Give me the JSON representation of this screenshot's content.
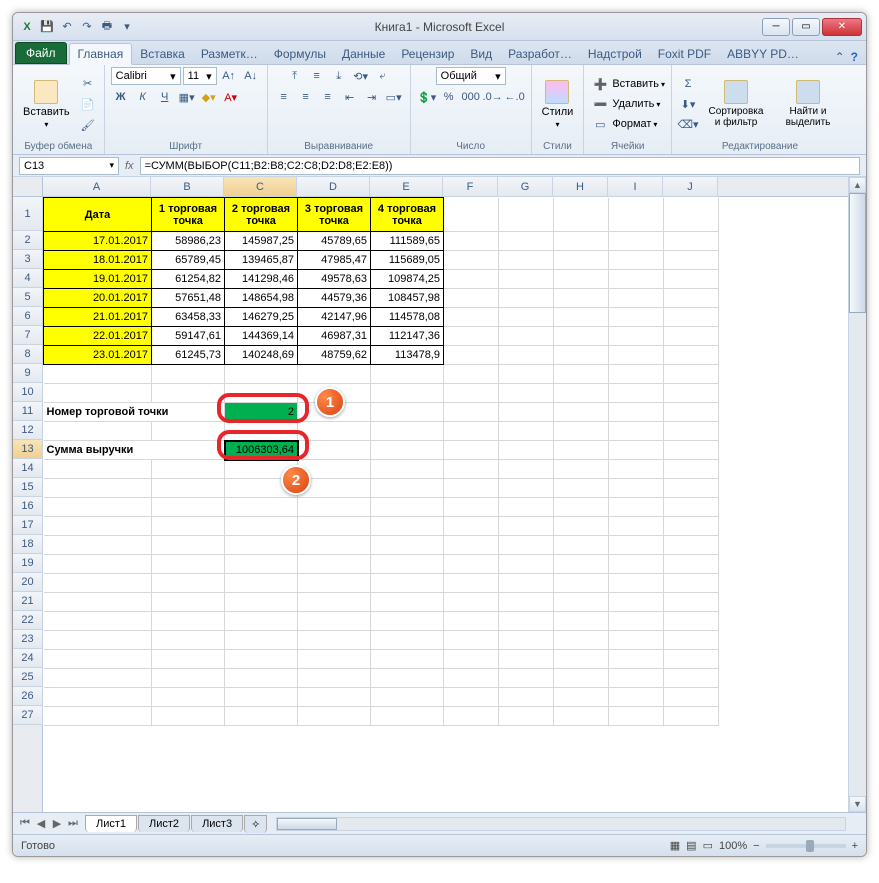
{
  "window": {
    "title": "Книга1 - Microsoft Excel",
    "min": "─",
    "max": "▭",
    "close": "✕"
  },
  "qat": {
    "excel": "X",
    "save": "💾",
    "undo": "↶",
    "redo": "↷",
    "print": "🖶"
  },
  "tabs": {
    "file": "Файл",
    "list": [
      "Главная",
      "Вставка",
      "Разметк…",
      "Формулы",
      "Данные",
      "Рецензир",
      "Вид",
      "Разработ…",
      "Надстрой",
      "Foxit PDF",
      "ABBYY PD…"
    ],
    "active": 0
  },
  "ribbon": {
    "clipboard": {
      "label": "Буфер обмена",
      "paste": "Вставить"
    },
    "font": {
      "label": "Шрифт",
      "name": "Calibri",
      "size": "11",
      "bold": "Ж",
      "italic": "К",
      "underline": "Ч"
    },
    "align": {
      "label": "Выравнивание"
    },
    "number": {
      "label": "Число",
      "format": "Общий"
    },
    "styles": {
      "label": "Стили",
      "btn": "Стили"
    },
    "cells": {
      "label": "Ячейки",
      "insert": "Вставить",
      "delete": "Удалить",
      "format": "Формат"
    },
    "editing": {
      "label": "Редактирование",
      "sort": "Сортировка и фильтр",
      "find": "Найти и выделить",
      "sigma": "Σ"
    }
  },
  "namebox": "C13",
  "formula": "=СУММ(ВЫБОР(C11;B2:B8;C2:C8;D2:D8;E2:E8))",
  "fx": "fx",
  "columns": [
    "A",
    "B",
    "C",
    "D",
    "E",
    "F",
    "G",
    "H",
    "I",
    "J"
  ],
  "rows_visible": 27,
  "headers": {
    "A": "Дата",
    "B": "1 торговая точка",
    "C": "2 торговая точка",
    "D": "3 торговая точка",
    "E": "4 торговая точка"
  },
  "data_rows": [
    {
      "date": "17.01.2017",
      "b": "58986,23",
      "c": "145987,25",
      "d": "45789,65",
      "e": "111589,65"
    },
    {
      "date": "18.01.2017",
      "b": "65789,45",
      "c": "139465,87",
      "d": "47985,47",
      "e": "115689,05"
    },
    {
      "date": "19.01.2017",
      "b": "61254,82",
      "c": "141298,46",
      "d": "49578,63",
      "e": "109874,25"
    },
    {
      "date": "20.01.2017",
      "b": "57651,48",
      "c": "148654,98",
      "d": "44579,36",
      "e": "108457,98"
    },
    {
      "date": "21.01.2017",
      "b": "63458,33",
      "c": "146279,25",
      "d": "42147,96",
      "e": "114578,08"
    },
    {
      "date": "22.01.2017",
      "b": "59147,61",
      "c": "144369,14",
      "d": "46987,31",
      "e": "112147,36"
    },
    {
      "date": "23.01.2017",
      "b": "61245,73",
      "c": "140248,69",
      "d": "48759,62",
      "e": "113478,9"
    }
  ],
  "row11_label": "Номер торговой точки",
  "row11_value": "2",
  "row13_label": "Сумма выручки",
  "row13_value": "1006303,64",
  "annotations": {
    "badge1": "1",
    "badge2": "2"
  },
  "sheets": {
    "s1": "Лист1",
    "s2": "Лист2",
    "s3": "Лист3"
  },
  "status": {
    "ready": "Готово",
    "zoom": "100%",
    "minus": "−",
    "plus": "+"
  },
  "view_icons": {
    "normal": "▦",
    "layout": "▤",
    "pb": "▭"
  }
}
